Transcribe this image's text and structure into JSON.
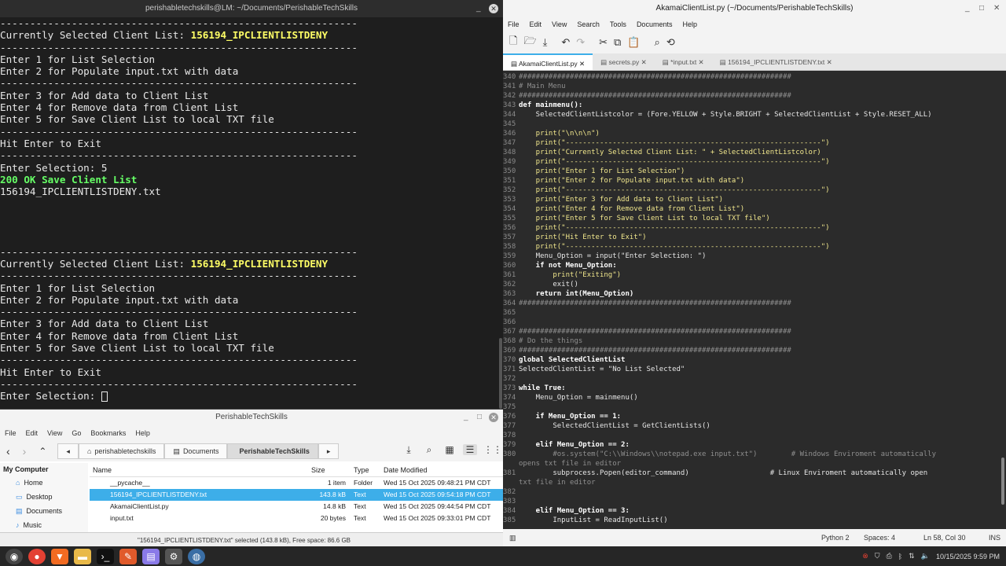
{
  "terminal": {
    "title": "perishabletechskills@LM: ~/Documents/PerishableTechSkills",
    "lines": [
      {
        "t": "------------------------------------------------------------",
        "cls": ""
      },
      {
        "t": "Currently Selected Client List: ",
        "hl": "156194_IPCLIENTLISTDENY",
        "cls": ""
      },
      {
        "t": "------------------------------------------------------------",
        "cls": ""
      },
      {
        "t": "Enter 1 for List Selection",
        "cls": ""
      },
      {
        "t": "Enter 2 for Populate input.txt with data",
        "cls": ""
      },
      {
        "t": "------------------------------------------------------------",
        "cls": ""
      },
      {
        "t": "Enter 3 for Add data to Client List",
        "cls": ""
      },
      {
        "t": "Enter 4 for Remove data from Client List",
        "cls": ""
      },
      {
        "t": "Enter 5 for Save Client List to local TXT file",
        "cls": ""
      },
      {
        "t": "------------------------------------------------------------",
        "cls": ""
      },
      {
        "t": "Hit Enter to Exit",
        "cls": ""
      },
      {
        "t": "------------------------------------------------------------",
        "cls": ""
      },
      {
        "t": "Enter Selection: 5",
        "cls": ""
      },
      {
        "t": "200 OK Save Client List",
        "cls": "green"
      },
      {
        "t": "156194_IPCLIENTLISTDENY.txt",
        "cls": ""
      },
      {
        "t": "",
        "cls": ""
      },
      {
        "t": "",
        "cls": ""
      },
      {
        "t": "",
        "cls": ""
      },
      {
        "t": "",
        "cls": ""
      },
      {
        "t": "------------------------------------------------------------",
        "cls": ""
      },
      {
        "t": "Currently Selected Client List: ",
        "hl": "156194_IPCLIENTLISTDENY",
        "cls": ""
      },
      {
        "t": "------------------------------------------------------------",
        "cls": ""
      },
      {
        "t": "Enter 1 for List Selection",
        "cls": ""
      },
      {
        "t": "Enter 2 for Populate input.txt with data",
        "cls": ""
      },
      {
        "t": "------------------------------------------------------------",
        "cls": ""
      },
      {
        "t": "Enter 3 for Add data to Client List",
        "cls": ""
      },
      {
        "t": "Enter 4 for Remove data from Client List",
        "cls": ""
      },
      {
        "t": "Enter 5 for Save Client List to local TXT file",
        "cls": ""
      },
      {
        "t": "------------------------------------------------------------",
        "cls": ""
      },
      {
        "t": "Hit Enter to Exit",
        "cls": ""
      },
      {
        "t": "------------------------------------------------------------",
        "cls": ""
      },
      {
        "t": "Enter Selection: ",
        "cls": "",
        "cursor": true
      }
    ]
  },
  "filemanager": {
    "title": "PerishableTechSkills",
    "menu": [
      "File",
      "Edit",
      "View",
      "Go",
      "Bookmarks",
      "Help"
    ],
    "breadcrumbs": [
      "perishabletechskills",
      "Documents",
      "PerishableTechSkills"
    ],
    "sidebar_header": "My Computer",
    "sidebar": [
      "Home",
      "Desktop",
      "Documents",
      "Music"
    ],
    "columns": [
      "Name",
      "Size",
      "Type",
      "Date Modified"
    ],
    "rows": [
      {
        "name": "__pycache__",
        "size": "1 item",
        "type": "Folder",
        "date": "Wed 15 Oct 2025 09:48:21 PM CDT",
        "sel": false
      },
      {
        "name": "156194_IPCLIENTLISTDENY.txt",
        "size": "143.8 kB",
        "type": "Text",
        "date": "Wed 15 Oct 2025 09:54:18 PM CDT",
        "sel": true
      },
      {
        "name": "AkamaiClientList.py",
        "size": "14.8 kB",
        "type": "Text",
        "date": "Wed 15 Oct 2025 09:44:54 PM CDT",
        "sel": false
      },
      {
        "name": "input.txt",
        "size": "20 bytes",
        "type": "Text",
        "date": "Wed 15 Oct 2025 09:33:01 PM CDT",
        "sel": false
      }
    ],
    "status": "\"156194_IPCLIENTLISTDENY.txt\" selected (143.8 kB), Free space: 86.6 GB"
  },
  "editor": {
    "title": "AkamaiClientList.py (~/Documents/PerishableTechSkills)",
    "menu": [
      "File",
      "Edit",
      "View",
      "Search",
      "Tools",
      "Documents",
      "Help"
    ],
    "tabs": [
      {
        "label": "AkamaiClientList.py",
        "active": true
      },
      {
        "label": "secrets.py",
        "active": false
      },
      {
        "label": "*input.txt",
        "active": false
      },
      {
        "label": "156194_IPCLIENTLISTDENY.txt",
        "active": false
      }
    ],
    "lines": [
      {
        "n": "340",
        "c": "################################################################",
        "k": "cm"
      },
      {
        "n": "341",
        "c": "# Main Menu",
        "k": "cm"
      },
      {
        "n": "342",
        "c": "################################################################",
        "k": "cm"
      },
      {
        "n": "343",
        "c": "def mainmenu():",
        "k": "def"
      },
      {
        "n": "344",
        "c": "    SelectedClientListcolor = (Fore.YELLOW + Style.BRIGHT + SelectedClientList + Style.RESET_ALL)",
        "k": ""
      },
      {
        "n": "345",
        "c": "",
        "k": ""
      },
      {
        "n": "346",
        "c": "    print(\"\\n\\n\\n\")",
        "k": "pr"
      },
      {
        "n": "347",
        "c": "    print(\"------------------------------------------------------------\")",
        "k": "pr"
      },
      {
        "n": "348",
        "c": "    print(\"Currently Selected Client List: \" + SelectedClientListcolor)",
        "k": "pr"
      },
      {
        "n": "349",
        "c": "    print(\"------------------------------------------------------------\")",
        "k": "pr"
      },
      {
        "n": "350",
        "c": "    print(\"Enter 1 for List Selection\")",
        "k": "pr"
      },
      {
        "n": "351",
        "c": "    print(\"Enter 2 for Populate input.txt with data\")",
        "k": "pr"
      },
      {
        "n": "352",
        "c": "    print(\"------------------------------------------------------------\")",
        "k": "pr"
      },
      {
        "n": "353",
        "c": "    print(\"Enter 3 for Add data to Client List\")",
        "k": "pr"
      },
      {
        "n": "354",
        "c": "    print(\"Enter 4 for Remove data from Client List\")",
        "k": "pr"
      },
      {
        "n": "355",
        "c": "    print(\"Enter 5 for Save Client List to local TXT file\")",
        "k": "pr"
      },
      {
        "n": "356",
        "c": "    print(\"------------------------------------------------------------\")",
        "k": "pr"
      },
      {
        "n": "357",
        "c": "    print(\"Hit Enter to Exit\")",
        "k": "pr"
      },
      {
        "n": "358",
        "c": "    print(\"------------------------------------------------------------\")",
        "k": "pr"
      },
      {
        "n": "359",
        "c": "    Menu_Option = input(\"Enter Selection: \")",
        "k": ""
      },
      {
        "n": "360",
        "c": "    if not Menu_Option:",
        "k": "kw"
      },
      {
        "n": "361",
        "c": "        print(\"Exiting\")",
        "k": "pr"
      },
      {
        "n": "362",
        "c": "        exit()",
        "k": ""
      },
      {
        "n": "363",
        "c": "    return int(Menu_Option)",
        "k": "kw"
      },
      {
        "n": "364",
        "c": "################################################################",
        "k": "cm"
      },
      {
        "n": "365",
        "c": "",
        "k": ""
      },
      {
        "n": "366",
        "c": "",
        "k": ""
      },
      {
        "n": "367",
        "c": "################################################################",
        "k": "cm"
      },
      {
        "n": "368",
        "c": "# Do the things",
        "k": "cm"
      },
      {
        "n": "369",
        "c": "################################################################",
        "k": "cm"
      },
      {
        "n": "370",
        "c": "global SelectedClientList",
        "k": "kw"
      },
      {
        "n": "371",
        "c": "SelectedClientList = \"No List Selected\"",
        "k": ""
      },
      {
        "n": "372",
        "c": "",
        "k": ""
      },
      {
        "n": "373",
        "c": "while True:",
        "k": "kw"
      },
      {
        "n": "374",
        "c": "    Menu_Option = mainmenu()",
        "k": ""
      },
      {
        "n": "375",
        "c": "",
        "k": ""
      },
      {
        "n": "376",
        "c": "    if Menu_Option == 1:",
        "k": "kw"
      },
      {
        "n": "377",
        "c": "        SelectedClientList = GetClientLists()",
        "k": ""
      },
      {
        "n": "378",
        "c": "",
        "k": ""
      },
      {
        "n": "379",
        "c": "    elif Menu_Option == 2:",
        "k": "kw"
      },
      {
        "n": "380",
        "c": "        #os.system(\"C:\\\\Windows\\\\notepad.exe input.txt\")        # Windows Enviroment automatically",
        "k": "cm"
      },
      {
        "n": "",
        "c": "opens txt file in editor",
        "k": "cm"
      },
      {
        "n": "381",
        "c": "        subprocess.Popen(editor_command)                   # Linux Enviroment automatically open",
        "k": ""
      },
      {
        "n": "",
        "c": "txt file in editor",
        "k": "cm"
      },
      {
        "n": "382",
        "c": "",
        "k": ""
      },
      {
        "n": "383",
        "c": "",
        "k": ""
      },
      {
        "n": "384",
        "c": "    elif Menu_Option == 3:",
        "k": "kw"
      },
      {
        "n": "385",
        "c": "        InputList = ReadInputList()",
        "k": ""
      }
    ],
    "status": {
      "lang": "Python 2",
      "spaces": "Spaces: 4",
      "pos": "Ln 58, Col 30",
      "mode": "INS"
    }
  },
  "taskbar": {
    "datetime": "10/15/2025  9:59 PM"
  }
}
